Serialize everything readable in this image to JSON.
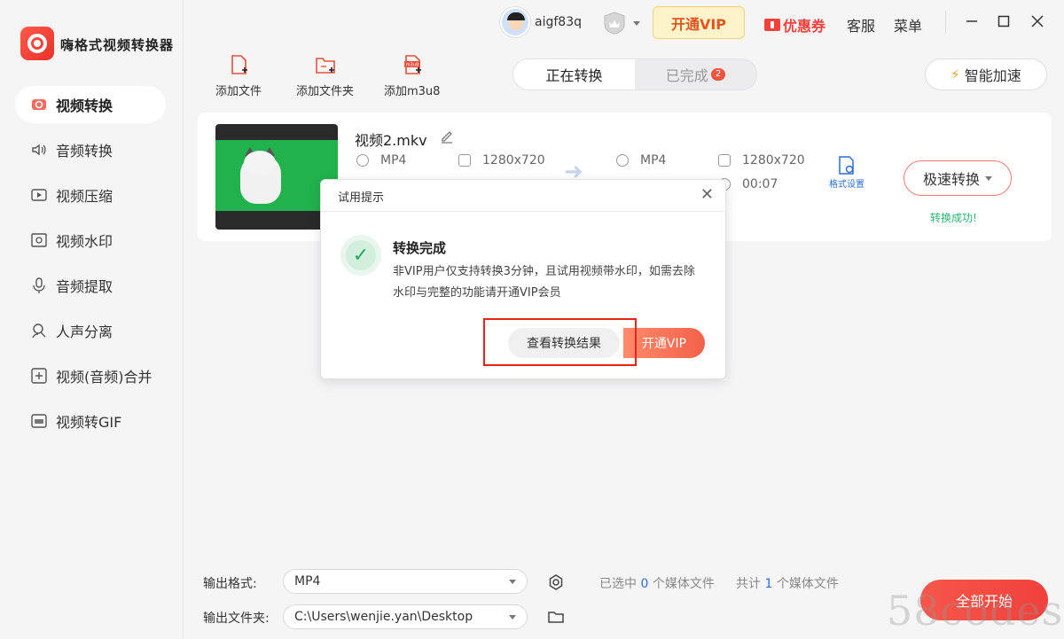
{
  "app": {
    "title": "嗨格式视频转换器"
  },
  "sidebar": {
    "items": [
      {
        "label": "视频转换",
        "icon": "video-convert-icon",
        "active": true
      },
      {
        "label": "音频转换",
        "icon": "speaker-icon"
      },
      {
        "label": "视频压缩",
        "icon": "video-compress-icon"
      },
      {
        "label": "视频水印",
        "icon": "watermark-icon"
      },
      {
        "label": "音频提取",
        "icon": "microphone-icon"
      },
      {
        "label": "人声分离",
        "icon": "vocal-separate-icon"
      },
      {
        "label": "视频(音频)合并",
        "icon": "merge-icon"
      },
      {
        "label": "视频转GIF",
        "icon": "gif-icon"
      }
    ]
  },
  "topbar": {
    "username": "aigf83q",
    "vip_label": "开通VIP",
    "coupon_label": "优惠券",
    "service_label": "客服",
    "menu_label": "菜单"
  },
  "toolbar": {
    "add_file": "添加文件",
    "add_folder": "添加文件夹",
    "add_m3u8": "添加m3u8",
    "m3u8_tag": "m3u8"
  },
  "tabs": {
    "converting": "正在转换",
    "completed": "已完成",
    "completed_count": "2"
  },
  "speed_label": "智能加速",
  "file": {
    "name": "视频2.mkv",
    "src_format": "MP4",
    "src_resolution": "1280x720",
    "dst_format": "MP4",
    "dst_resolution": "1280x720",
    "dst_duration": "00:07",
    "format_settings": "格式设置",
    "fast_convert": "极速转换",
    "status": "转换成功!"
  },
  "dialog": {
    "title": "试用提示",
    "heading": "转换完成",
    "body": "非VIP用户仅支持转换3分钟，且试用视频带水印，如需去除水印与完整的功能请开通VIP会员",
    "view_result": "查看转换结果",
    "open_vip": "开通VIP"
  },
  "bottom": {
    "output_format_label": "输出格式:",
    "output_format_value": "MP4",
    "output_folder_label": "输出文件夹:",
    "output_folder_value": "C:\\Users\\wenjie.yan\\Desktop",
    "selected_prefix": "已选中",
    "selected_count": "0",
    "selected_suffix": "个媒体文件",
    "total_prefix": "共计",
    "total_count": "1",
    "total_suffix": "个媒体文件",
    "start_all": "全部开始"
  },
  "watermark": "58codes",
  "colors": {
    "accent": "#f0413c",
    "link": "#2b6ed7",
    "success": "#2bb673",
    "vip_bg": "#fff3c9"
  }
}
